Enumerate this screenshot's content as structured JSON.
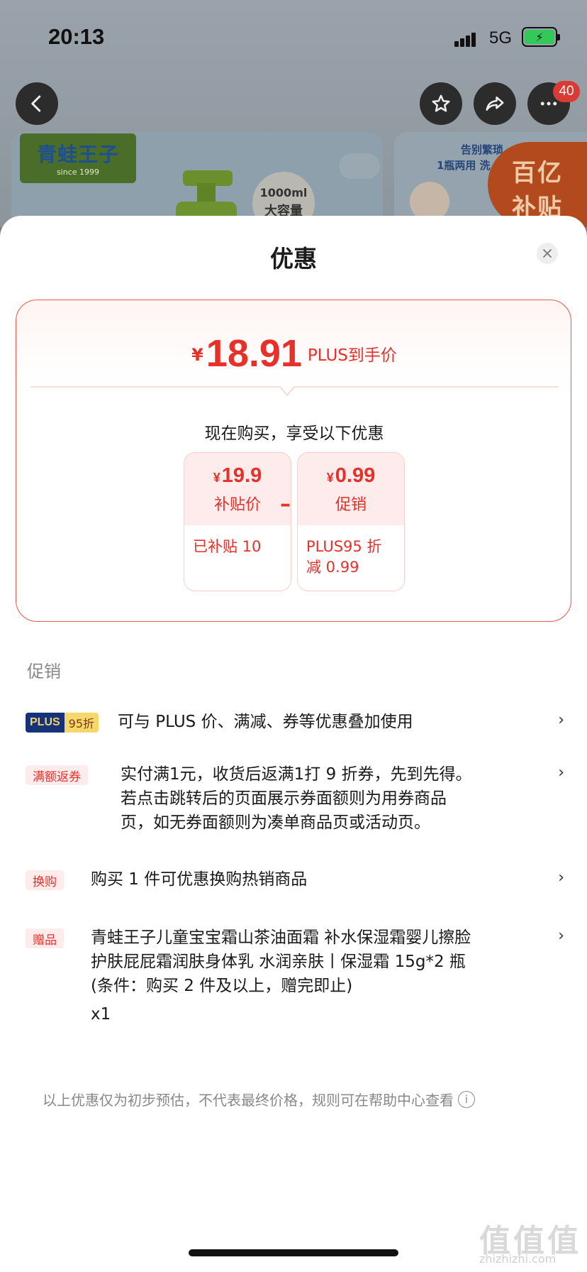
{
  "status_bar": {
    "time": "20:13",
    "network": "5G"
  },
  "background_page": {
    "menu_badge_count": "40",
    "banner_left": {
      "brand": "青蛙王子",
      "brand_since": "since 1999",
      "volume_amount": "1000ml",
      "volume_label": "大容量"
    },
    "banner_right": {
      "line1": "告别繁琐",
      "line2": "1瓶两用 洗",
      "subsidy_line1": "百亿",
      "subsidy_line2": "补贴"
    }
  },
  "sheet": {
    "title": "优惠",
    "final_price": {
      "currency": "¥",
      "amount": "18.91",
      "label": "PLUS到手价"
    },
    "buy_now_text": "现在购买，享受以下优惠",
    "breakdown": [
      {
        "currency": "¥",
        "value": "19.9",
        "label": "补贴价",
        "detail": "已补贴 10"
      },
      {
        "currency": "¥",
        "value": "0.99",
        "label": "促销",
        "detail": "PLUS95 折减 0.99"
      }
    ],
    "operator": "–",
    "section_label": "促销",
    "promotions": [
      {
        "tag_part1": "PLUS",
        "tag_part2": "95折",
        "text": "可与 PLUS 价、满减、券等优惠叠加使用"
      },
      {
        "tag": "满额返券",
        "text_lines": [
          "实付满1元，收货后返满1打 9 折券，先到先得。",
          "若点击跳转后的页面展示券面额则为用券商品",
          "页，如无券面额则为凑单商品页或活动页。"
        ]
      },
      {
        "tag": "换购",
        "text": "购买 1 件可优惠换购热销商品"
      },
      {
        "tag": "赠品",
        "text_lines": [
          "青蛙王子儿童宝宝霜山茶油面霜 补水保湿霜婴儿擦脸",
          "护肤屁屁霜润肤身体乳 水润亲肤丨保湿霜 15g*2 瓶",
          "(条件：购买 2 件及以上，赠完即止)"
        ],
        "quantity": "x1"
      }
    ],
    "footer_note": "以上优惠仅为初步预估，不代表最终价格，规则可在帮助中心查看",
    "info_glyph": "i"
  },
  "watermark": {
    "text": "值值值",
    "site": "zhizhizhi.com"
  },
  "colors": {
    "accent_red": "#e8302a",
    "tag_bg": "#fdeceb",
    "plus_navy": "#16337a",
    "plus_gold": "#f5d76a"
  },
  "icons": {
    "back": "chevron-left-icon",
    "favorite": "star-icon",
    "share": "share-icon",
    "more": "more-dots-icon",
    "close": "close-icon",
    "chevron": "chevron-right-icon",
    "info": "info-icon"
  }
}
